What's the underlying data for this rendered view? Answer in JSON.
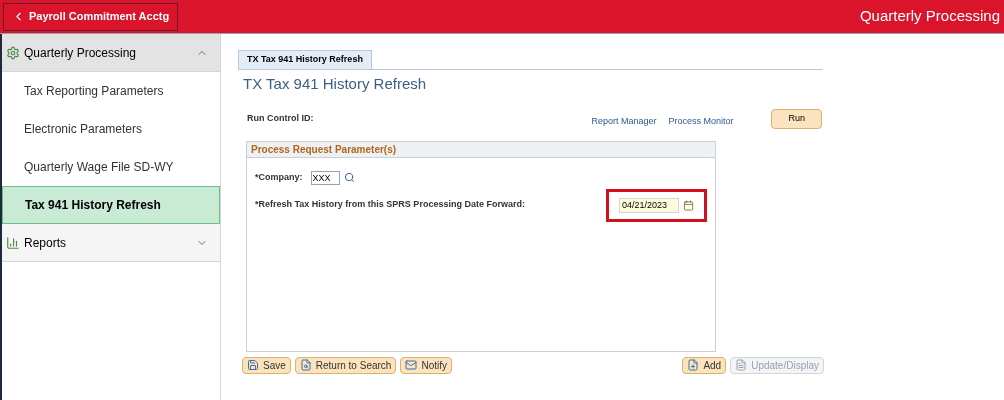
{
  "header": {
    "back_button": "Payroll Commitment Acctg",
    "title": "Quarterly Processing"
  },
  "sidebar": {
    "sections": [
      {
        "label": "Quarterly Processing",
        "expanded": true,
        "items": [
          {
            "label": "Tax Reporting Parameters",
            "selected": false
          },
          {
            "label": "Electronic Parameters",
            "selected": false
          },
          {
            "label": "Quarterly Wage File SD-WY",
            "selected": false
          },
          {
            "label": "Tax 941 History Refresh",
            "selected": true
          }
        ]
      },
      {
        "label": "Reports",
        "expanded": false
      }
    ]
  },
  "tab": {
    "label": "TX Tax 941 History Refresh",
    "selected": true
  },
  "page_title": "TX Tax 941 History Refresh",
  "run_control": {
    "label": "Run Control ID:",
    "links": [
      "Report Manager",
      "Process Monitor"
    ],
    "run_button": "Run"
  },
  "parameters": {
    "title": "Process Request Parameter(s)",
    "company": {
      "label": "*Company:",
      "value": "XXX"
    },
    "date": {
      "label": "*Refresh Tax History from this SPRS Processing Date Forward:",
      "value": "04/21/2023",
      "highlighted": true
    }
  },
  "toolbar_left": [
    {
      "label": "Save",
      "disabled": false
    },
    {
      "label": "Return to Search",
      "disabled": false
    },
    {
      "label": "Notify",
      "disabled": false
    }
  ],
  "toolbar_right": [
    {
      "label": "Add",
      "disabled": false
    },
    {
      "label": "Update/Display",
      "disabled": true
    }
  ]
}
